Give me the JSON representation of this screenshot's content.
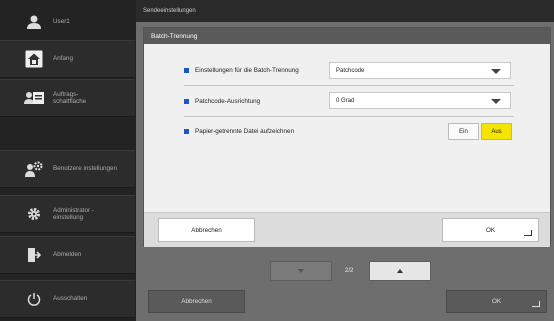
{
  "sidebar": {
    "user": "User1",
    "home": "Anfang",
    "job_button_line1": "Auftrags-",
    "job_button_line2": "schaltfläche",
    "user_settings": "Benutzere instellungen",
    "admin_line1": "Administrator -",
    "admin_line2": "einstellung",
    "logout": "Abmelden",
    "shutdown": "Ausschalten"
  },
  "header": {
    "title": "Sendeeinstellungen"
  },
  "dialog": {
    "title": "Batch-Trennung",
    "rows": [
      {
        "label": "Einstellungen für die Batch-Trennung",
        "value": "Patchcode"
      },
      {
        "label": "Patchcode-Ausrichtung",
        "value": "0 Grad"
      },
      {
        "label": "Papier-getrennte Datei aufzeichnen"
      }
    ],
    "toggle_on": "Ein",
    "toggle_off": "Aus",
    "toggle_selected": "Aus",
    "cancel": "Abbrechen",
    "ok": "OK"
  },
  "pager": {
    "text": "2/2"
  },
  "bottom": {
    "cancel": "Abbrechen",
    "ok": "OK"
  },
  "colors": {
    "accent_yellow": "#f4e500",
    "marker_blue": "#1c55c6"
  }
}
